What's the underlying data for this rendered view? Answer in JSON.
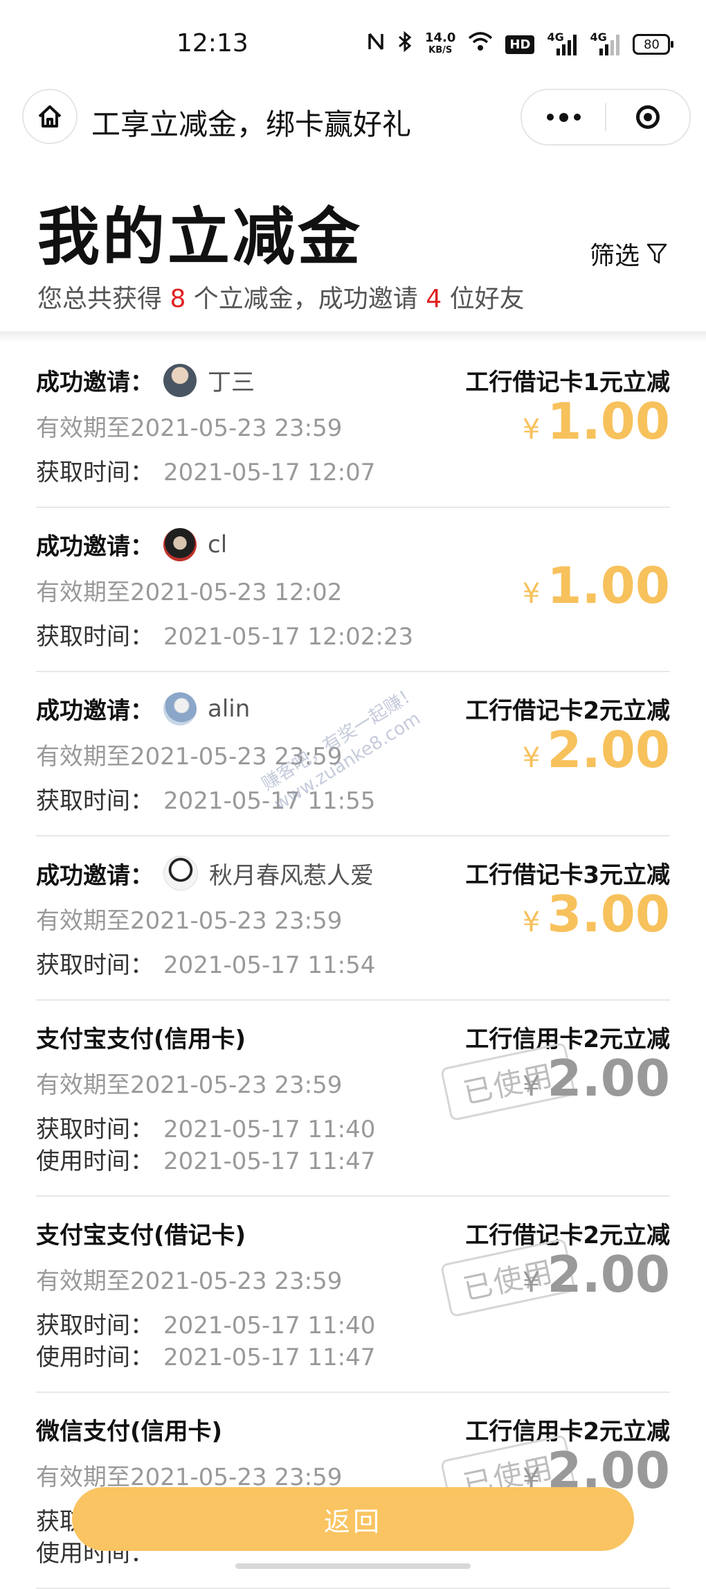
{
  "status_bar": {
    "time": "12:13",
    "speed_value": "14.0",
    "speed_unit": "KB/S",
    "hd_label": "HD",
    "net1": "4G",
    "net2": "4G",
    "battery": "80"
  },
  "nav": {
    "title": "工享立减金，绑卡赢好礼"
  },
  "header": {
    "title": "我的立减金",
    "filter_label": "筛选",
    "summary_prefix": "您总共获得 ",
    "coupon_count": "8",
    "summary_mid": " 个立减金，成功邀请 ",
    "friend_count": "4",
    "summary_suffix": " 位好友"
  },
  "watermark": {
    "line1": "赚客吧，有奖一起赚！",
    "line2": "www.zuanke8.com"
  },
  "items": [
    {
      "source": "成功邀请：",
      "invitee": "丁三",
      "coupon_name": "工行借记卡1元立减",
      "validity": "有效期至2021-05-23 23:59",
      "obtain_label": "获取时间：",
      "obtain_time": "2021-05-17 12:07",
      "yen": "¥",
      "amount": "1.00",
      "status": "active",
      "avatar_color": "#6b7b8c"
    },
    {
      "source": "成功邀请：",
      "invitee": "cl",
      "coupon_name": "",
      "validity": "有效期至2021-05-23 12:02",
      "obtain_label": "获取时间：",
      "obtain_time": "2021-05-17 12:02:23",
      "yen": "¥",
      "amount": "1.00",
      "status": "active",
      "avatar_color": "#b8302a"
    },
    {
      "source": "成功邀请：",
      "invitee": "alin",
      "coupon_name": "工行借记卡2元立减",
      "validity": "有效期至2021-05-23 23:59",
      "obtain_label": "获取时间：",
      "obtain_time": "2021-05-17 11:55",
      "yen": "¥",
      "amount": "2.00",
      "status": "active",
      "avatar_color": "#8aa6c8"
    },
    {
      "source": "成功邀请：",
      "invitee": "秋月春风惹人爱",
      "coupon_name": "工行借记卡3元立减",
      "validity": "有效期至2021-05-23 23:59",
      "obtain_label": "获取时间：",
      "obtain_time": "2021-05-17 11:54",
      "yen": "¥",
      "amount": "3.00",
      "status": "active",
      "avatar_color": "#3a3a3a"
    },
    {
      "source": "支付宝支付(信用卡)",
      "coupon_name": "工行信用卡2元立减",
      "validity": "有效期至2021-05-23 23:59",
      "obtain_label": "获取时间：",
      "obtain_time": "2021-05-17 11:40",
      "use_label": "使用时间：",
      "use_time": "2021-05-17 11:47",
      "stamp": "已使用",
      "yen": "¥",
      "amount": "2.00",
      "status": "used"
    },
    {
      "source": "支付宝支付(借记卡)",
      "coupon_name": "工行借记卡2元立减",
      "validity": "有效期至2021-05-23 23:59",
      "obtain_label": "获取时间：",
      "obtain_time": "2021-05-17 11:40",
      "use_label": "使用时间：",
      "use_time": "2021-05-17 11:47",
      "stamp": "已使用",
      "yen": "¥",
      "amount": "2.00",
      "status": "used"
    },
    {
      "source": "微信支付(信用卡)",
      "coupon_name": "工行信用卡2元立减",
      "validity": "有效期至2021-05-23 23:59",
      "obtain_label": "获取时间：",
      "obtain_time": "",
      "use_label": "使用时间：",
      "use_time": "",
      "stamp": "已使用",
      "yen": "¥",
      "amount": "2.00",
      "status": "used"
    }
  ],
  "footer": {
    "back_label": "返回"
  },
  "colors": {
    "accent": "#f9c461",
    "amount_active": "#f7c15c",
    "amount_used": "#999999",
    "highlight_red": "#e02020"
  }
}
